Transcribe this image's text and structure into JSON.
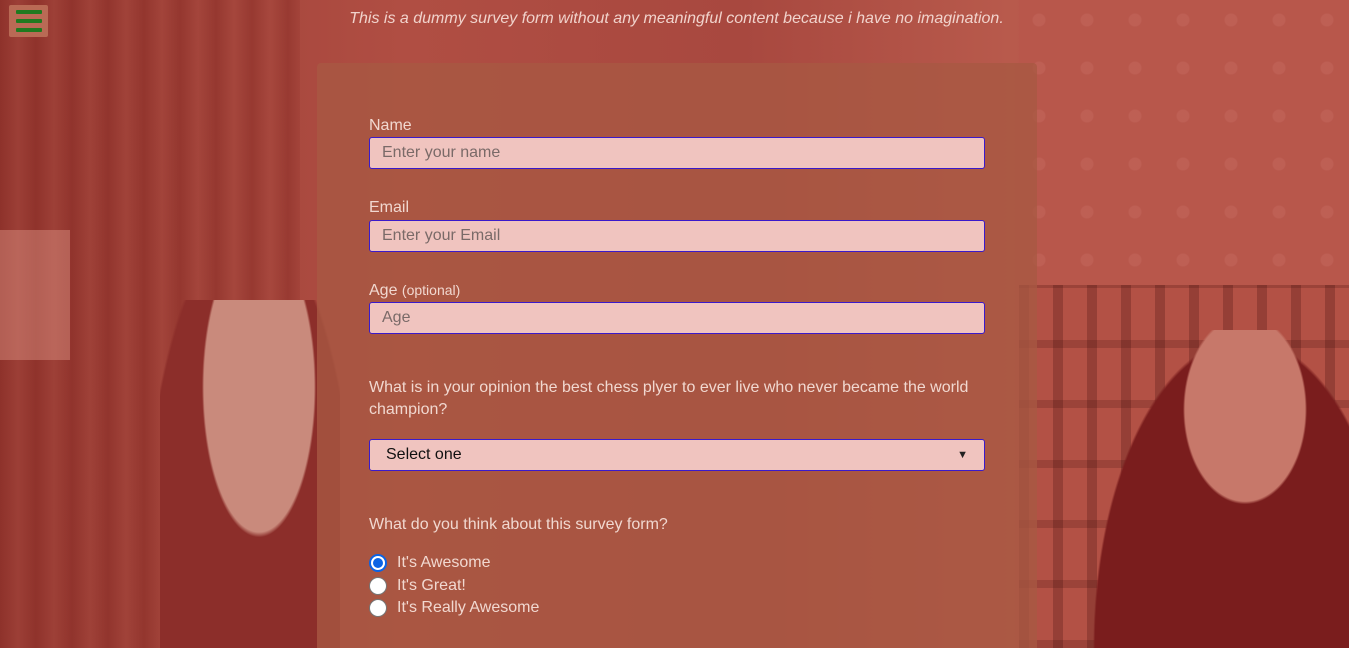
{
  "header": {
    "subtitle": "This is a dummy survey form without any meaningful content because i have no imagination."
  },
  "form": {
    "name": {
      "label": "Name",
      "placeholder": "Enter your name"
    },
    "email": {
      "label": "Email",
      "placeholder": "Enter your Email"
    },
    "age": {
      "label": "Age",
      "optional_note": "(optional)",
      "placeholder": "Age"
    },
    "chess_question": {
      "text": "What is in your opinion the best chess plyer to ever live who never became the world champion?",
      "selected": "Select one"
    },
    "opinion_question": {
      "text": "What do you think about this survey form?",
      "options": [
        "It's Awesome",
        "It's Great!",
        "It's Really Awesome"
      ],
      "selected_index": 0
    }
  },
  "colors": {
    "input_border": "#3a1acb",
    "input_bg": "#f0c4bf",
    "menu_icon": "#1f7a1f",
    "radio_checked": "#0b63e4"
  },
  "icons": {
    "menu": "hamburger-icon",
    "select": "chevron-down-icon"
  }
}
